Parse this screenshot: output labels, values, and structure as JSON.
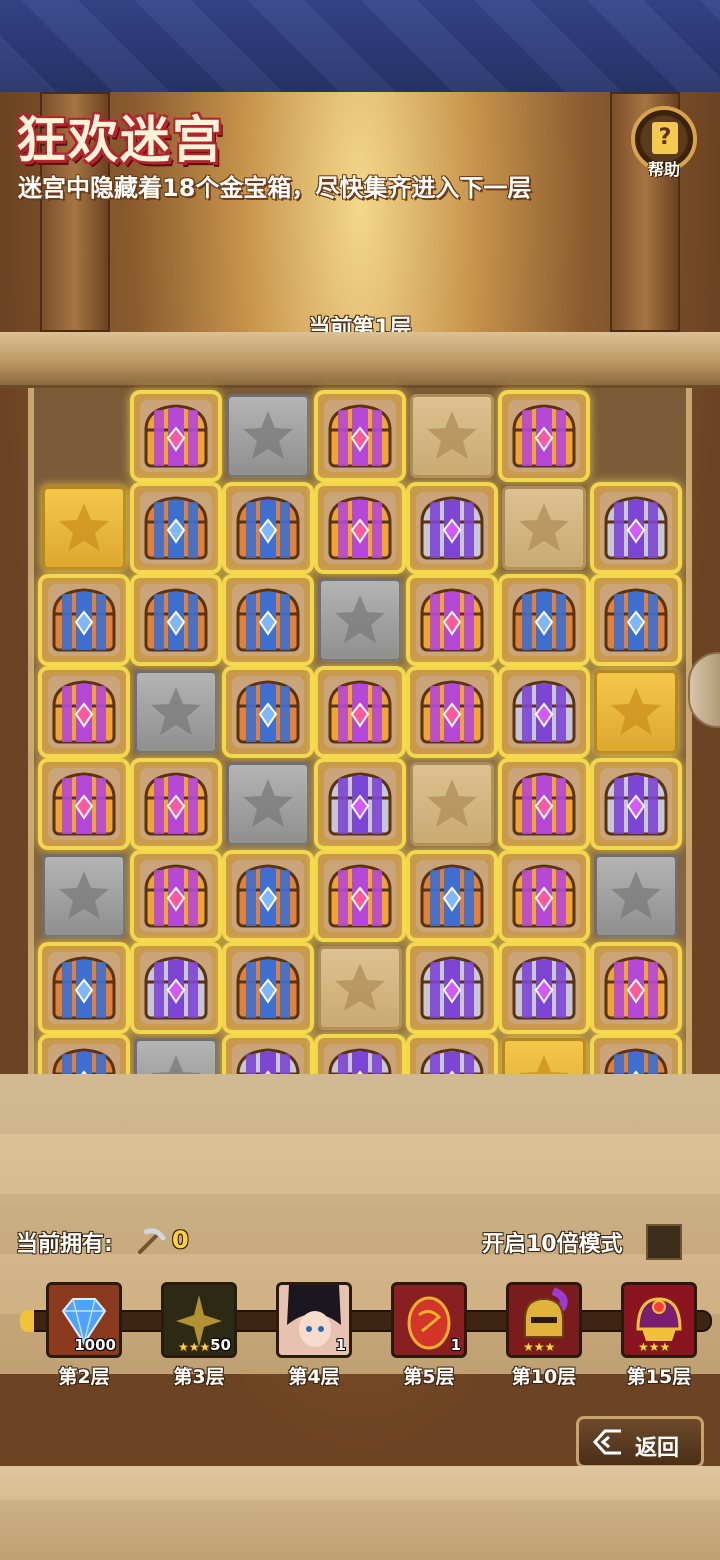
{
  "header": {
    "title": "狂欢迷宫",
    "subtitle": "迷宫中隐藏着18个金宝箱，尽快集齐进入下一层",
    "help_label": "帮助",
    "help_glyph": "?"
  },
  "floor": {
    "label": "当前第1层"
  },
  "grid": [
    [
      "empty",
      "chest-purple",
      "stone-gray",
      "chest-purple",
      "stone-sand",
      "chest-purple",
      "empty"
    ],
    [
      "stone-gold",
      "chest-blue",
      "chest-blue",
      "chest-purple",
      "chest-silver",
      "stone-sand",
      "chest-silver"
    ],
    [
      "chest-blue",
      "chest-blue",
      "chest-blue",
      "stone-gray",
      "chest-purple",
      "chest-blue",
      "chest-blue"
    ],
    [
      "chest-purple",
      "stone-gray",
      "chest-blue",
      "chest-purple",
      "chest-purple",
      "chest-silver",
      "stone-gold"
    ],
    [
      "chest-purple",
      "chest-purple",
      "stone-gray",
      "chest-silver",
      "stone-sand",
      "chest-purple",
      "chest-silver"
    ],
    [
      "stone-gray",
      "chest-purple",
      "chest-blue",
      "chest-purple",
      "chest-blue",
      "chest-purple",
      "stone-gray"
    ],
    [
      "chest-blue",
      "chest-silver",
      "chest-blue",
      "stone-sand",
      "chest-silver",
      "chest-silver",
      "chest-purple"
    ],
    [
      "chest-blue",
      "stone-gray",
      "chest-silver",
      "chest-silver",
      "chest-silver",
      "stone-gold",
      "chest-blue"
    ]
  ],
  "colors": {
    "chest-purple": {
      "body": "#f0a630",
      "band": "#b548d6",
      "gem": "#ff5aa0"
    },
    "chest-blue": {
      "body": "#e0823a",
      "band": "#3d6fd0",
      "gem": "#7fb7ff"
    },
    "chest-silver": {
      "body": "#c9c6d8",
      "band": "#7d45d6",
      "gem": "#d45aff"
    }
  },
  "inventory": {
    "owned_label": "当前拥有:",
    "pickaxe_icon": "pickaxe-icon",
    "pickaxe_count": "0",
    "mode_label": "开启10倍模式",
    "mode_enabled": false
  },
  "rewards": [
    {
      "icon": "diamond-icon",
      "amount": "1000",
      "stars": "",
      "label": "第2层",
      "bg": "#8b3a1e"
    },
    {
      "icon": "shadow-hero-icon",
      "amount": "50",
      "stars": "★★★★",
      "label": "第3层",
      "bg": "#2c2a14"
    },
    {
      "icon": "hero-portrait-icon",
      "amount": "1",
      "stars": "",
      "label": "第4层",
      "bg": "#e8c2b0"
    },
    {
      "icon": "dragon-egg-icon",
      "amount": "1",
      "stars": "",
      "label": "第5层",
      "bg": "#8a1f22"
    },
    {
      "icon": "knight-helmet-icon",
      "amount": "",
      "stars": "★★★",
      "label": "第10层",
      "bg": "#7a1c1e"
    },
    {
      "icon": "jeweled-helmet-icon",
      "amount": "",
      "stars": "★★★",
      "label": "第15层",
      "bg": "#8a1420"
    }
  ],
  "back_button": {
    "label": "返回"
  }
}
